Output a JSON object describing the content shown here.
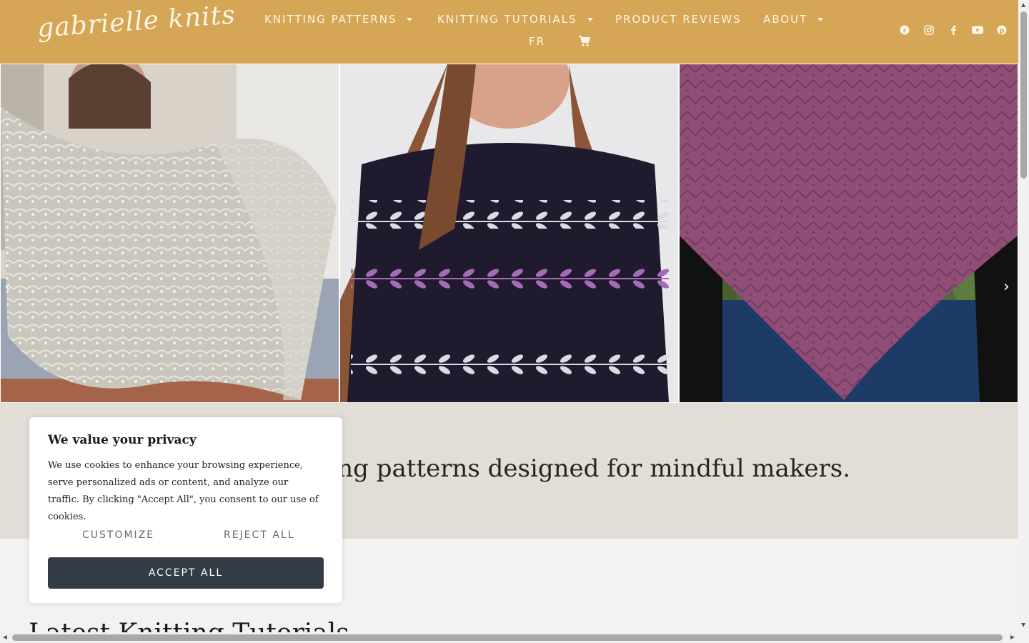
{
  "header": {
    "logo": "gabrielle knits",
    "nav": [
      {
        "label": "KNITTING PATTERNS",
        "has_dropdown": true
      },
      {
        "label": "KNITTING TUTORIALS",
        "has_dropdown": true
      },
      {
        "label": "PRODUCT REVIEWS",
        "has_dropdown": false
      },
      {
        "label": "ABOUT",
        "has_dropdown": true
      },
      {
        "label": "FR",
        "has_dropdown": false
      }
    ],
    "cart_icon": "cart-icon",
    "social_icons": [
      "ravelry-icon",
      "instagram-icon",
      "facebook-icon",
      "youtube-icon",
      "pinterest-icon"
    ],
    "background": "#d4a656"
  },
  "gallery": {
    "prev_icon": "chevron-left-icon",
    "next_icon": "chevron-right-icon",
    "images": [
      "grey lace shawl",
      "navy colorwork sweater",
      "purple lace shawl"
    ]
  },
  "tagline": "t knitting patterns designed for mindful makers.",
  "latest_heading": "Latest Knitting Tutorials",
  "cookie": {
    "title": "We value your privacy",
    "body": "We use cookies to enhance your browsing experience, serve personalized ads or content, and analyze our traffic. By clicking \"Accept All\", you consent to our use of cookies.",
    "customize": "CUSTOMIZE",
    "reject": "REJECT ALL",
    "accept": "ACCEPT ALL"
  }
}
